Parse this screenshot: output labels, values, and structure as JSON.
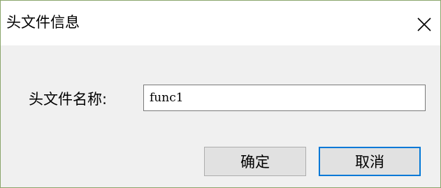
{
  "dialog": {
    "title": "头文件信息",
    "close_icon": "close-x-icon"
  },
  "form": {
    "header_name_label": "头文件名称:",
    "header_name_value": "func1"
  },
  "buttons": {
    "ok_label": "确定",
    "cancel_label": "取消"
  },
  "colors": {
    "window_border": "#8aa56b",
    "dialog_background": "#f0f0f0",
    "titlebar_background": "#ffffff",
    "button_background": "#e1e1e1",
    "button_border": "#adadad",
    "focus_border": "#0078d7"
  }
}
